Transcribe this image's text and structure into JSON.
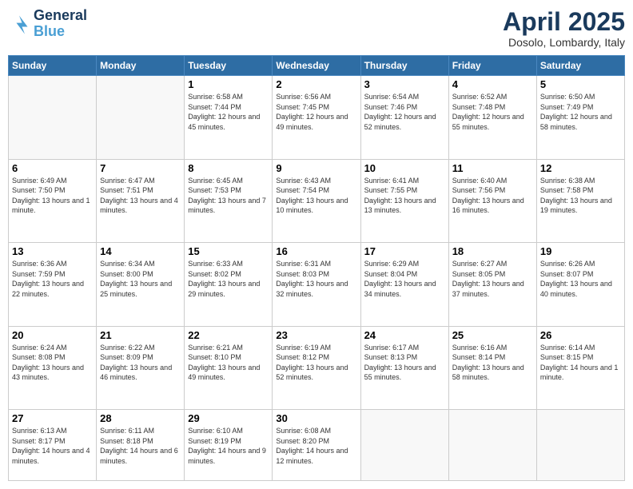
{
  "logo": {
    "line1": "General",
    "line2": "Blue"
  },
  "header": {
    "title": "April 2025",
    "subtitle": "Dosolo, Lombardy, Italy"
  },
  "weekdays": [
    "Sunday",
    "Monday",
    "Tuesday",
    "Wednesday",
    "Thursday",
    "Friday",
    "Saturday"
  ],
  "weeks": [
    [
      {
        "day": "",
        "empty": true
      },
      {
        "day": "",
        "empty": true
      },
      {
        "day": "1",
        "sunrise": "6:58 AM",
        "sunset": "7:44 PM",
        "daylight": "12 hours and 45 minutes."
      },
      {
        "day": "2",
        "sunrise": "6:56 AM",
        "sunset": "7:45 PM",
        "daylight": "12 hours and 49 minutes."
      },
      {
        "day": "3",
        "sunrise": "6:54 AM",
        "sunset": "7:46 PM",
        "daylight": "12 hours and 52 minutes."
      },
      {
        "day": "4",
        "sunrise": "6:52 AM",
        "sunset": "7:48 PM",
        "daylight": "12 hours and 55 minutes."
      },
      {
        "day": "5",
        "sunrise": "6:50 AM",
        "sunset": "7:49 PM",
        "daylight": "12 hours and 58 minutes."
      }
    ],
    [
      {
        "day": "6",
        "sunrise": "6:49 AM",
        "sunset": "7:50 PM",
        "daylight": "13 hours and 1 minute."
      },
      {
        "day": "7",
        "sunrise": "6:47 AM",
        "sunset": "7:51 PM",
        "daylight": "13 hours and 4 minutes."
      },
      {
        "day": "8",
        "sunrise": "6:45 AM",
        "sunset": "7:53 PM",
        "daylight": "13 hours and 7 minutes."
      },
      {
        "day": "9",
        "sunrise": "6:43 AM",
        "sunset": "7:54 PM",
        "daylight": "13 hours and 10 minutes."
      },
      {
        "day": "10",
        "sunrise": "6:41 AM",
        "sunset": "7:55 PM",
        "daylight": "13 hours and 13 minutes."
      },
      {
        "day": "11",
        "sunrise": "6:40 AM",
        "sunset": "7:56 PM",
        "daylight": "13 hours and 16 minutes."
      },
      {
        "day": "12",
        "sunrise": "6:38 AM",
        "sunset": "7:58 PM",
        "daylight": "13 hours and 19 minutes."
      }
    ],
    [
      {
        "day": "13",
        "sunrise": "6:36 AM",
        "sunset": "7:59 PM",
        "daylight": "13 hours and 22 minutes."
      },
      {
        "day": "14",
        "sunrise": "6:34 AM",
        "sunset": "8:00 PM",
        "daylight": "13 hours and 25 minutes."
      },
      {
        "day": "15",
        "sunrise": "6:33 AM",
        "sunset": "8:02 PM",
        "daylight": "13 hours and 29 minutes."
      },
      {
        "day": "16",
        "sunrise": "6:31 AM",
        "sunset": "8:03 PM",
        "daylight": "13 hours and 32 minutes."
      },
      {
        "day": "17",
        "sunrise": "6:29 AM",
        "sunset": "8:04 PM",
        "daylight": "13 hours and 34 minutes."
      },
      {
        "day": "18",
        "sunrise": "6:27 AM",
        "sunset": "8:05 PM",
        "daylight": "13 hours and 37 minutes."
      },
      {
        "day": "19",
        "sunrise": "6:26 AM",
        "sunset": "8:07 PM",
        "daylight": "13 hours and 40 minutes."
      }
    ],
    [
      {
        "day": "20",
        "sunrise": "6:24 AM",
        "sunset": "8:08 PM",
        "daylight": "13 hours and 43 minutes."
      },
      {
        "day": "21",
        "sunrise": "6:22 AM",
        "sunset": "8:09 PM",
        "daylight": "13 hours and 46 minutes."
      },
      {
        "day": "22",
        "sunrise": "6:21 AM",
        "sunset": "8:10 PM",
        "daylight": "13 hours and 49 minutes."
      },
      {
        "day": "23",
        "sunrise": "6:19 AM",
        "sunset": "8:12 PM",
        "daylight": "13 hours and 52 minutes."
      },
      {
        "day": "24",
        "sunrise": "6:17 AM",
        "sunset": "8:13 PM",
        "daylight": "13 hours and 55 minutes."
      },
      {
        "day": "25",
        "sunrise": "6:16 AM",
        "sunset": "8:14 PM",
        "daylight": "13 hours and 58 minutes."
      },
      {
        "day": "26",
        "sunrise": "6:14 AM",
        "sunset": "8:15 PM",
        "daylight": "14 hours and 1 minute."
      }
    ],
    [
      {
        "day": "27",
        "sunrise": "6:13 AM",
        "sunset": "8:17 PM",
        "daylight": "14 hours and 4 minutes."
      },
      {
        "day": "28",
        "sunrise": "6:11 AM",
        "sunset": "8:18 PM",
        "daylight": "14 hours and 6 minutes."
      },
      {
        "day": "29",
        "sunrise": "6:10 AM",
        "sunset": "8:19 PM",
        "daylight": "14 hours and 9 minutes."
      },
      {
        "day": "30",
        "sunrise": "6:08 AM",
        "sunset": "8:20 PM",
        "daylight": "14 hours and 12 minutes."
      },
      {
        "day": "",
        "empty": true
      },
      {
        "day": "",
        "empty": true
      },
      {
        "day": "",
        "empty": true
      }
    ]
  ]
}
